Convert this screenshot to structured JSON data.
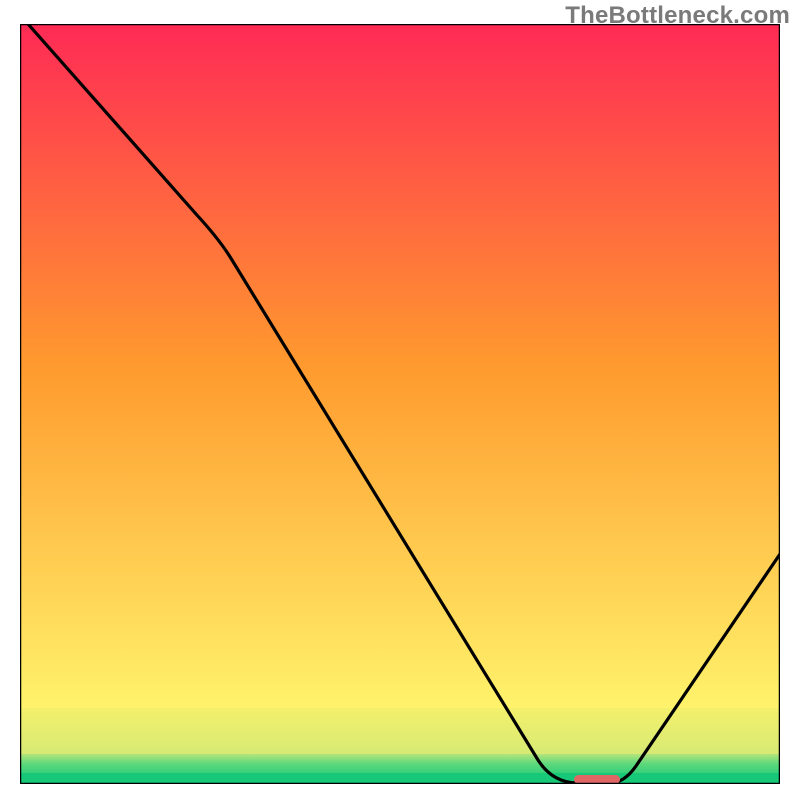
{
  "watermark": "TheBottleneck.com",
  "chart_data": {
    "type": "line",
    "title": "",
    "xlabel": "",
    "ylabel": "",
    "xlim": [
      0,
      100
    ],
    "ylim": [
      0,
      100
    ],
    "grid": false,
    "curve_points": [
      {
        "x": 2,
        "y": 100
      },
      {
        "x": 25,
        "y": 74
      },
      {
        "x": 70,
        "y": 2
      },
      {
        "x": 74,
        "y": 0
      },
      {
        "x": 78,
        "y": 0
      },
      {
        "x": 100,
        "y": 30
      }
    ],
    "curve_smooth": true,
    "marker": {
      "x_start": 73.5,
      "x_end": 78.5,
      "y": 0.5,
      "color": "#e06666",
      "thickness_px": 9
    },
    "bands": [
      {
        "y0": 0.0,
        "y1": 1.5,
        "color": "#17d07a"
      },
      {
        "y0": 1.5,
        "y1": 4.0,
        "color": "#8be27a"
      },
      {
        "y0": 4.0,
        "y1": 10.0,
        "color": "#e8f07a"
      },
      {
        "y0": 10.0,
        "y1": 100,
        "color_gradient": {
          "from": "#fff36b",
          "to": "#ff2a55"
        }
      }
    ]
  }
}
